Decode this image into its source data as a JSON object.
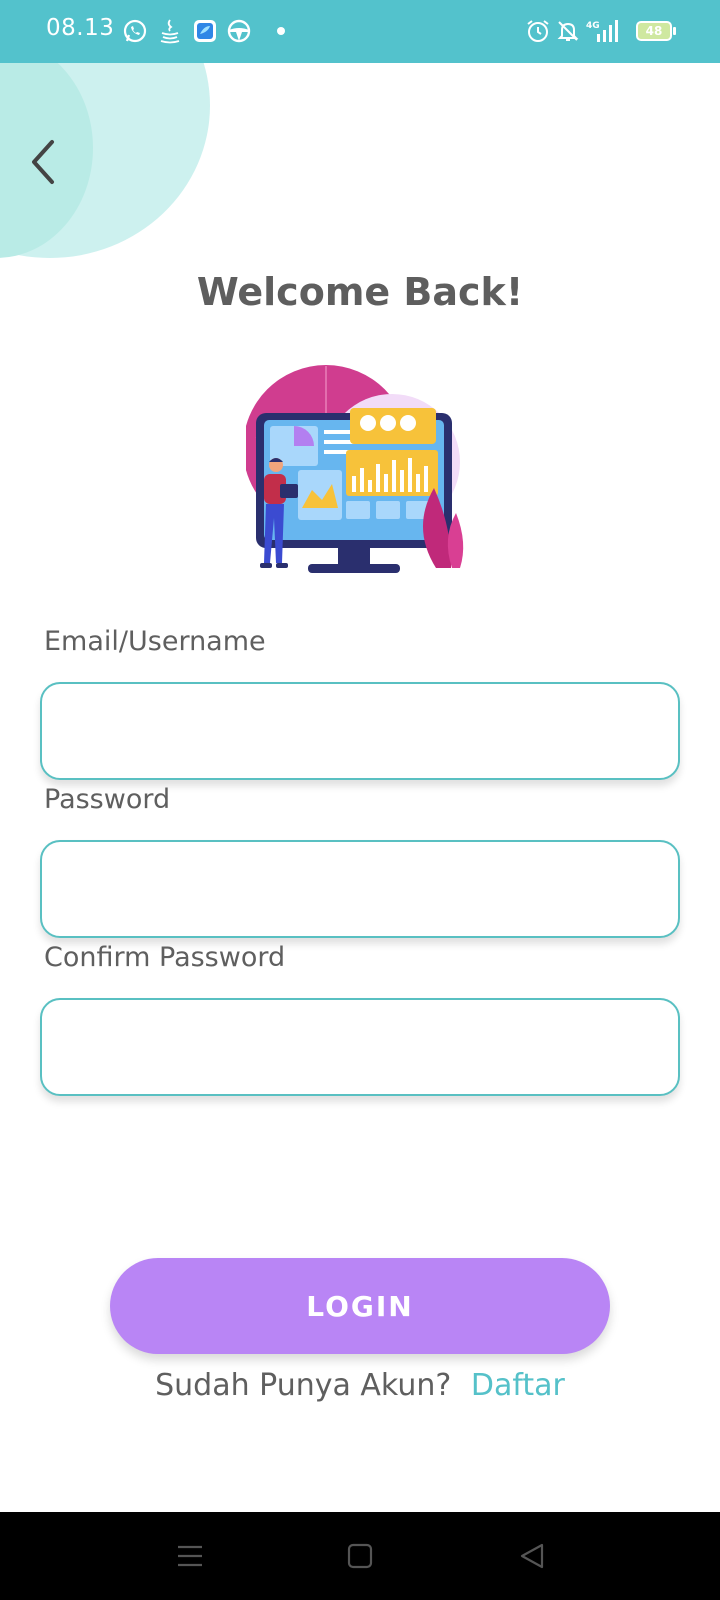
{
  "status_bar": {
    "time": "08.13",
    "battery": "48",
    "icons": [
      "whatsapp-icon",
      "java-icon",
      "app-icon",
      "steering-icon",
      "dot-icon",
      "alarm-icon",
      "bell-off-icon",
      "signal-4g-icon",
      "battery-icon"
    ]
  },
  "header": {
    "back_icon": "chevron-left-icon",
    "title": "Welcome Back!"
  },
  "form": {
    "email_label": "Email/Username",
    "email_value": "",
    "password_label": "Password",
    "password_value": "",
    "confirm_label": "Confirm Password",
    "confirm_value": ""
  },
  "actions": {
    "login_label": "LOGIN",
    "register_prompt": "Sudah Punya Akun?",
    "register_link": "Daftar"
  },
  "colors": {
    "status_bar": "#53c2cc",
    "accent_teal": "#55c1c9",
    "button_purple": "#b985f5",
    "title_gray": "#5e5e5e"
  },
  "nav_bar": {
    "icons": [
      "menu-icon",
      "home-square-icon",
      "back-triangle-icon"
    ]
  }
}
